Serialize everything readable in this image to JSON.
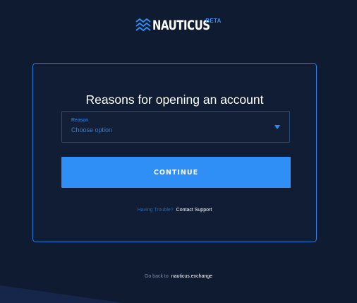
{
  "brand": {
    "name": "NAUTICUS",
    "badge": "BETA",
    "icon": "waves-logo-icon"
  },
  "form": {
    "title": "Reasons for opening an account",
    "reason_select": {
      "label": "Reason",
      "value": "Choose option",
      "icon": "caret-down-icon"
    },
    "continue_label": "CONTINUE",
    "help_prompt": "Having Trouble?",
    "help_link": "Contact Support"
  },
  "footer": {
    "text": "Go back to",
    "link": "nauticus.exchange"
  },
  "colors": {
    "background": "#0f1b31",
    "accent": "#2f8ff7",
    "card_border": "#2b7de0",
    "field_border": "#2a4a77"
  }
}
